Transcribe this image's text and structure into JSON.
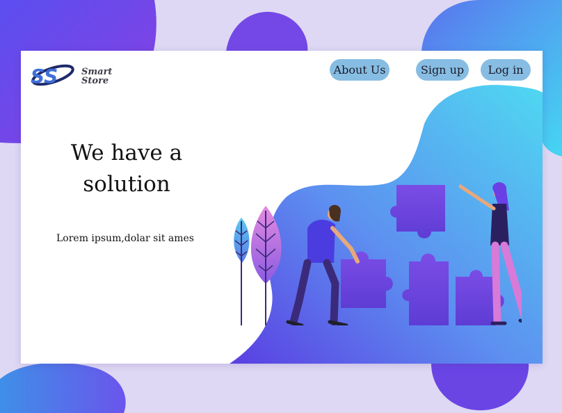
{
  "brand": {
    "logo_monogram": "SS",
    "name_line1": "Smart",
    "name_line2": "Store"
  },
  "nav": {
    "about_label": "About Us",
    "signup_label": "Sign up",
    "login_label": "Log in"
  },
  "hero": {
    "headline": "We have a solution",
    "subtext": "Lorem ipsum,dolar sit ames"
  },
  "illustration": {
    "name": "team-puzzle-illustration"
  },
  "colors": {
    "page_background": "#ded8f4",
    "blob_purple": "#6b3fe6",
    "blob_cyan": "#4fd3ef",
    "nav_button": "#87bde3",
    "card": "#ffffff",
    "text": "#121212"
  }
}
